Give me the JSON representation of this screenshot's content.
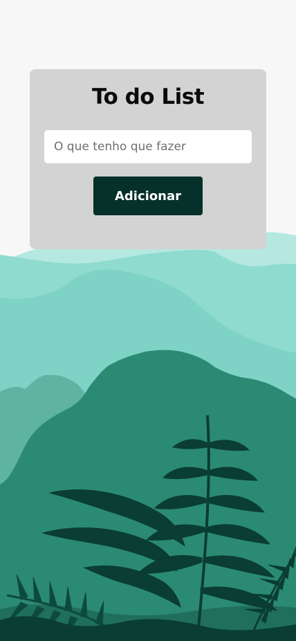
{
  "card": {
    "title": "To do List",
    "input_placeholder": "O que tenho que fazer",
    "input_value": "",
    "add_button_label": "Adicionar"
  },
  "colors": {
    "page_background": "#f7f7f7",
    "card_background": "#d3d3d3",
    "button_background": "#06302a",
    "button_text": "#ffffff",
    "title_text": "#0a0a0a",
    "sky_mist": "#b5e8e0",
    "far_hills": "#8fdbcf",
    "mid_hills": "#78cfc1",
    "near_hills": "#5fb3a2",
    "forest": "#2b8a73",
    "foliage_dark": "#0a3d33"
  },
  "background": {
    "illustration": "jungle-landscape"
  }
}
